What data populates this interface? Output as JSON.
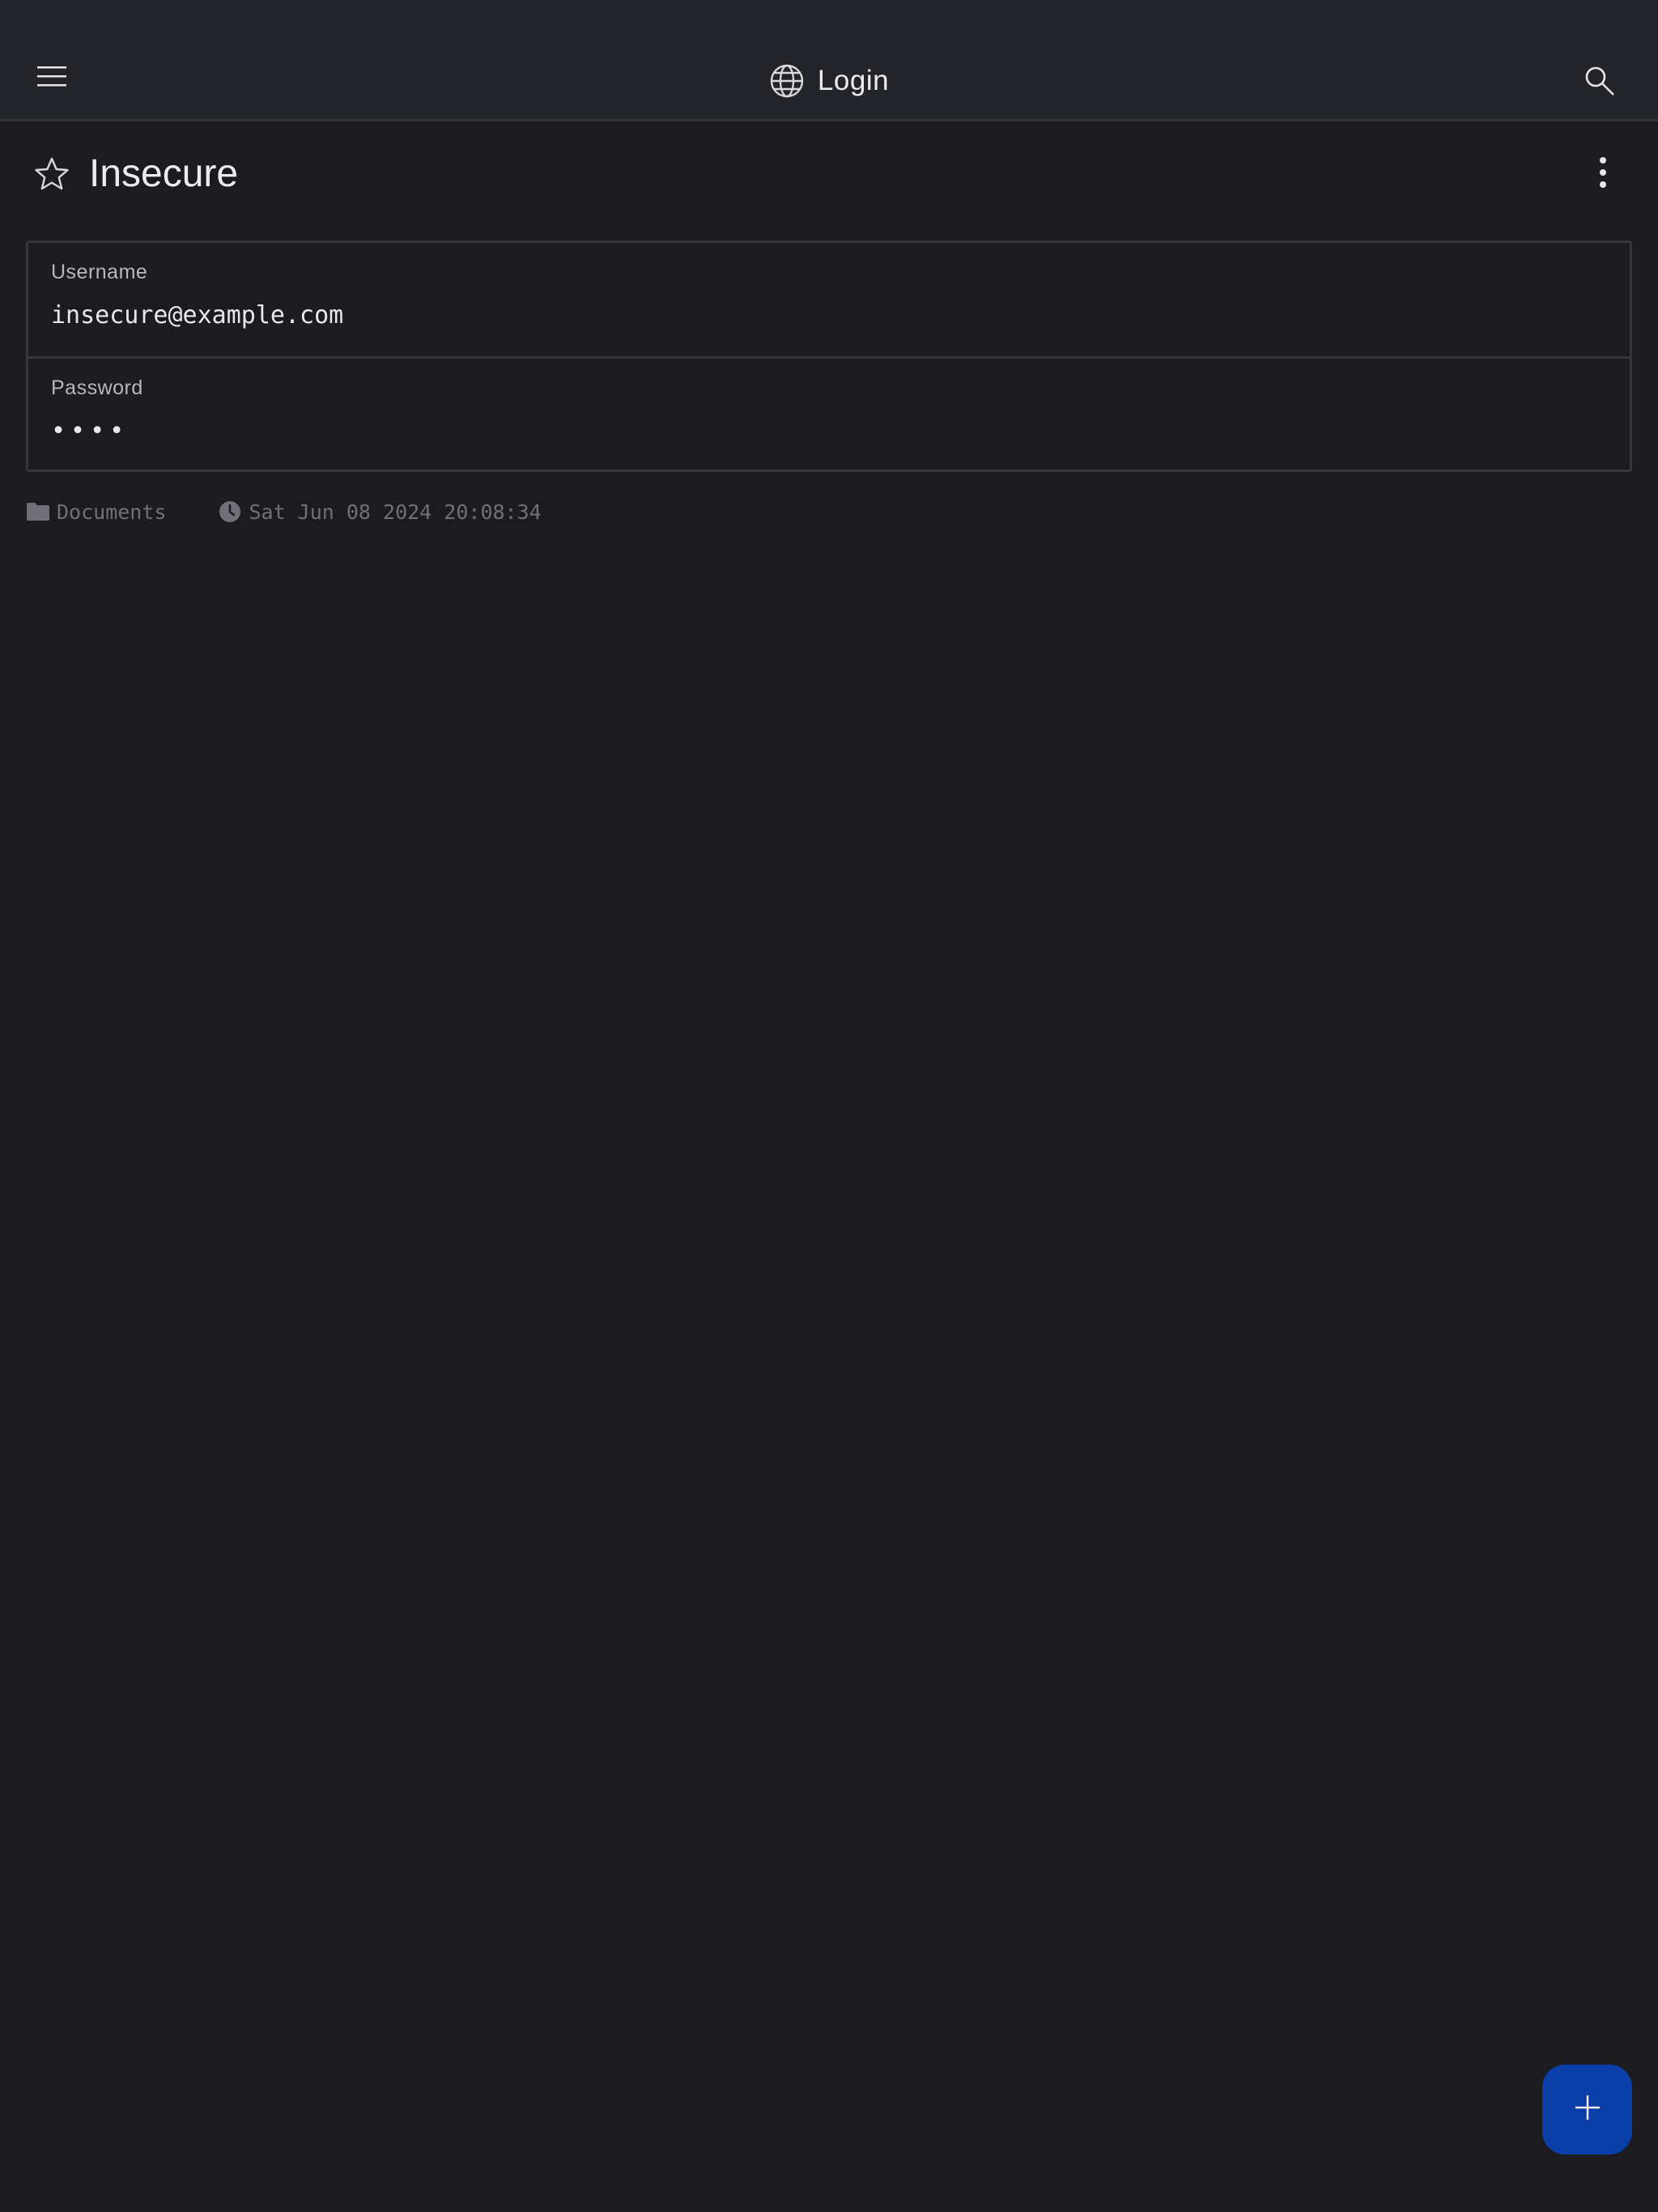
{
  "header": {
    "title": "Login",
    "menu_icon": "hamburger-menu-icon",
    "title_icon": "globe-icon",
    "search_icon": "search-icon"
  },
  "item": {
    "title": "Insecure",
    "favorite_icon": "star-outline-icon",
    "more_icon": "more-vertical-icon"
  },
  "fields": [
    {
      "label": "Username",
      "value": "insecure@example.com"
    },
    {
      "label": "Password",
      "value": "••••"
    }
  ],
  "meta": {
    "folder": "Documents",
    "modified": "Sat Jun 08 2024 20:08:34",
    "folder_icon": "folder-icon",
    "time_icon": "clock-icon"
  },
  "fab": {
    "icon": "plus-icon"
  },
  "colors": {
    "background": "#1c1c20",
    "topbar": "#232429",
    "fab": "#0a3ea8",
    "muted_text": "#6f7078"
  }
}
